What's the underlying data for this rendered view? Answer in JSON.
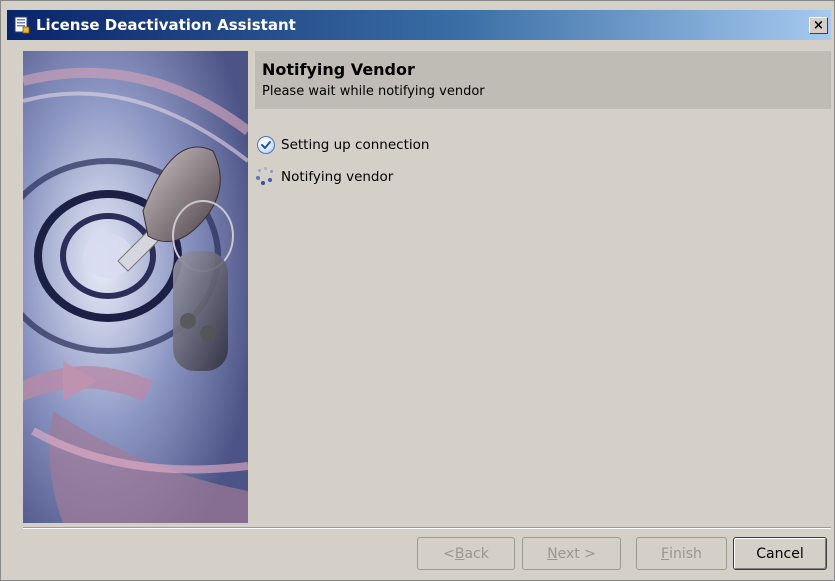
{
  "window": {
    "title": "License Deactivation Assistant",
    "close_label": "×"
  },
  "header": {
    "title": "Notifying Vendor",
    "subtitle": "Please wait while notifying vendor"
  },
  "steps": [
    {
      "label": "Setting up connection",
      "status": "done",
      "icon": "check-circle-icon"
    },
    {
      "label": "Notifying vendor",
      "status": "in-progress",
      "icon": "spinner-icon"
    }
  ],
  "buttons": {
    "back_prefix": "< ",
    "back_mnemonic": "B",
    "back_rest": "ack",
    "next_mnemonic": "N",
    "next_rest": "ext >",
    "finish_mnemonic": "F",
    "finish_rest": "inish",
    "cancel_label": "Cancel"
  },
  "colors": {
    "titlebar_start": "#0a246a",
    "titlebar_end": "#a6caf0",
    "dialog_bg": "#d4d0c8",
    "header_band": "#bfbcb5",
    "disabled_text": "#9a978f"
  }
}
